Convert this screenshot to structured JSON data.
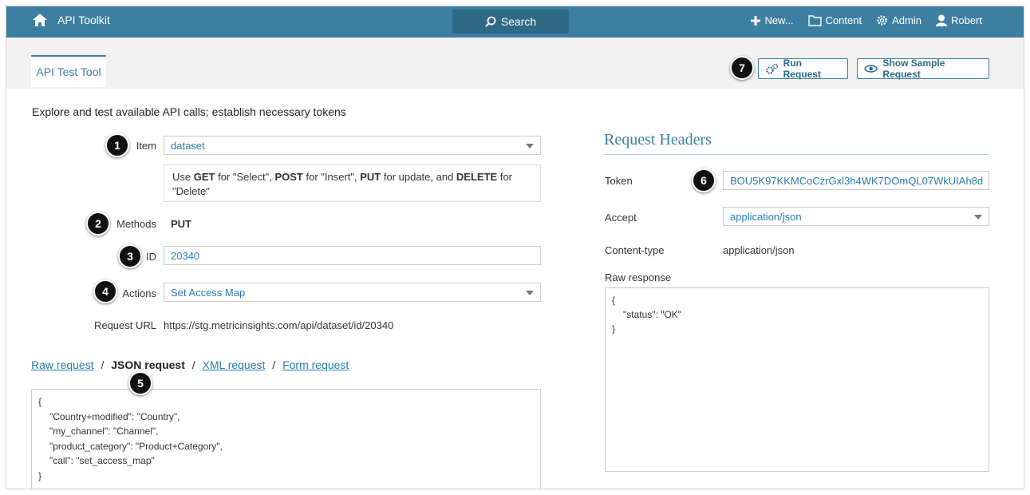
{
  "topbar": {
    "app_title": "API Toolkit",
    "search_label": "Search",
    "nav": {
      "new": "New...",
      "content": "Content",
      "admin": "Admin",
      "user": "Robert"
    }
  },
  "tab": {
    "label": "API Test Tool"
  },
  "buttons": {
    "run": "Run Request",
    "sample": "Show Sample Request"
  },
  "description": "Explore and test available API calls; establish necessary tokens",
  "form": {
    "item_label": "Item",
    "item_value": "dataset",
    "note": {
      "use": "Use ",
      "get": "GET",
      "get_text": " for \"Select\", ",
      "post": "POST",
      "post_text": " for \"Insert\", ",
      "put": "PUT",
      "put_text": " for update, and ",
      "delete": "DELETE",
      "delete_text": " for \"Delete\""
    },
    "methods_label": "Methods",
    "methods_value": "PUT",
    "id_label": "ID",
    "id_value": "20340",
    "actions_label": "Actions",
    "actions_value": "Set Access Map",
    "url_label": "Request URL",
    "url_value": "https://stg.metricinsights.com/api/dataset/id/20340"
  },
  "request_links": {
    "raw": "Raw request",
    "json": "JSON request",
    "xml": "XML request",
    "form": "Form request",
    "sep": "/"
  },
  "json_request": [
    "{",
    "\"Country+modified\": \"Country\",",
    "\"my_channel\": \"Channel\",",
    "\"product_category\": \"Product+Category\",",
    "\"call\": \"set_access_map\"",
    "}"
  ],
  "headers": {
    "title": "Request Headers",
    "token_label": "Token",
    "token_value": "BOU5K97KKMCoCzrGxl3h4WK7DOmQL07WkUIAh8d",
    "accept_label": "Accept",
    "accept_value": "application/json",
    "content_type_label": "Content-type",
    "content_type_value": "application/json",
    "raw_response_label": "Raw response",
    "raw_response": [
      "{",
      "\"status\": \"OK\"",
      "}"
    ]
  },
  "badges": [
    "1",
    "2",
    "3",
    "4",
    "5",
    "6",
    "7"
  ],
  "colors": {
    "header": "#3c7fa0",
    "search": "#2e6985",
    "link": "#2b7cae"
  }
}
